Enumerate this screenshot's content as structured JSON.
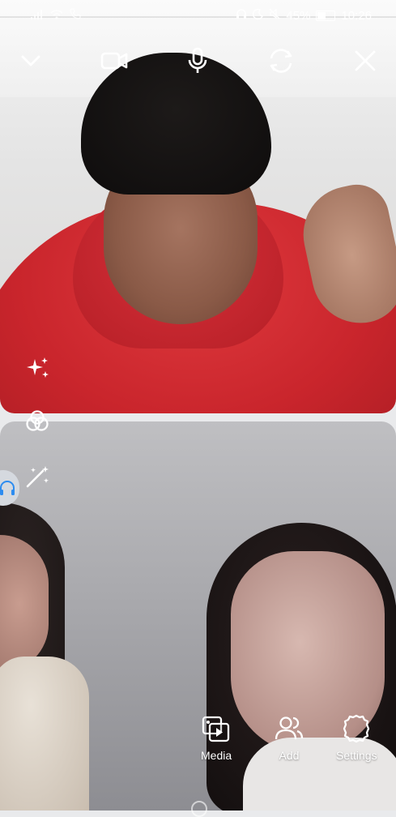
{
  "status_bar": {
    "battery": "45%",
    "time": "10:26",
    "icons": [
      "signal-icon",
      "wifi-icon",
      "phone-icon",
      "headset-icon",
      "moon-icon",
      "mute-icon",
      "battery-icon"
    ]
  },
  "controls": {
    "icons": [
      "chevron-down-icon",
      "video-camera-icon",
      "microphone-icon",
      "switch-camera-icon",
      "close-icon"
    ]
  },
  "effects": {
    "icons": [
      "sparkles-icon",
      "filter-circles-icon",
      "magic-wand-icon",
      "headphones-icon"
    ]
  },
  "actions": {
    "media_label": "Media",
    "add_label": "Add",
    "settings_label": "Settings"
  },
  "colors": {
    "hoodie_red": "#c9252c",
    "pill": "#d5d9df"
  }
}
